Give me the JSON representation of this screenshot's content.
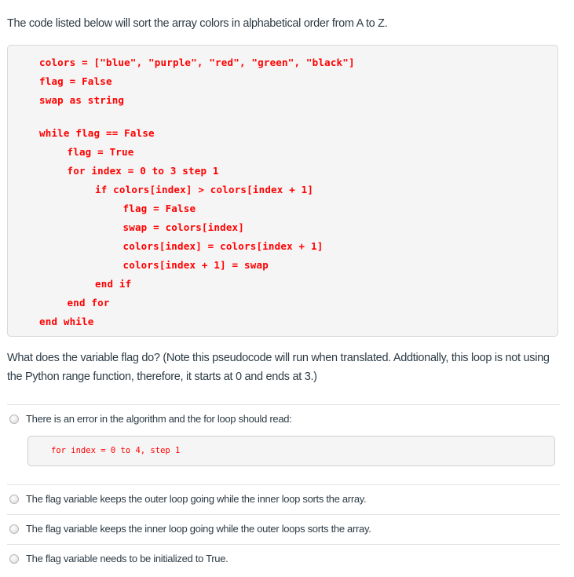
{
  "intro": "The code listed below will sort the array colors in alphabetical order from A to Z.",
  "code": {
    "lines": [
      {
        "text": "colors = [\"blue\", \"purple\", \"red\", \"green\", \"black\"]",
        "indent": 0
      },
      {
        "text": "flag = False",
        "indent": 0
      },
      {
        "text": "swap as string",
        "indent": 0
      },
      {
        "text": "",
        "indent": 0
      },
      {
        "text": "while flag == False",
        "indent": 0
      },
      {
        "text": "flag = True",
        "indent": 1
      },
      {
        "text": "for index = 0 to 3 step 1",
        "indent": 1
      },
      {
        "text": "if colors[index] > colors[index + 1]",
        "indent": 2
      },
      {
        "text": "flag = False",
        "indent": 3
      },
      {
        "text": "swap = colors[index]",
        "indent": 3
      },
      {
        "text": "colors[index] = colors[index + 1]",
        "indent": 3
      },
      {
        "text": "colors[index + 1] = swap",
        "indent": 3
      },
      {
        "text": "end if",
        "indent": 2
      },
      {
        "text": "end for",
        "indent": 1
      },
      {
        "text": "end while",
        "indent": 0
      }
    ]
  },
  "question": "What does the variable flag do?  (Note this pseudocode will run when translated.  Addtionally, this loop is not using the Python range function, therefore, it starts at 0 and ends at 3.)",
  "answers": [
    {
      "label": "There is an error in the algorithm and the for loop should read:",
      "code": "for index = 0 to 4, step 1",
      "selected": false
    },
    {
      "label": "The flag variable keeps the outer loop going while the inner loop sorts the array.",
      "selected": false
    },
    {
      "label": "The flag variable keeps the inner loop going while the outer loops sorts the array.",
      "selected": false
    },
    {
      "label": "The flag variable needs to be initialized to True.",
      "selected": false
    }
  ]
}
